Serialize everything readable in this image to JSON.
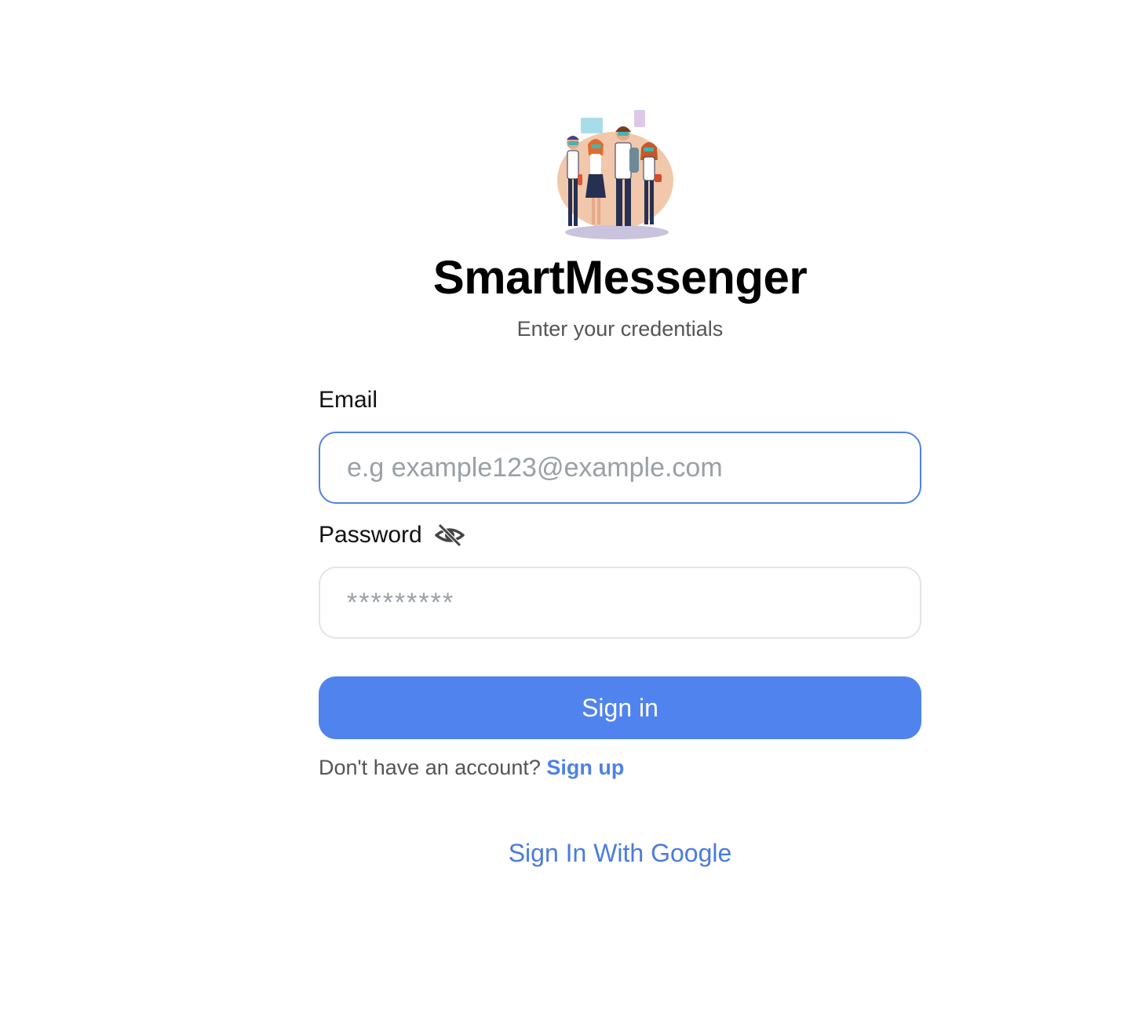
{
  "app": {
    "title": "SmartMessenger",
    "subtitle": "Enter your credentials"
  },
  "form": {
    "email_label": "Email",
    "email_placeholder": "e.g example123@example.com",
    "email_value": "",
    "password_label": "Password",
    "password_placeholder": "*********",
    "password_value": "",
    "signin_label": "Sign in",
    "signup_prompt": "Don't have an account?",
    "signup_link": "Sign up",
    "google_link": "Sign In With Google"
  },
  "icons": {
    "logo": "people-group-illustration",
    "password_toggle": "eye-slash-icon"
  },
  "colors": {
    "accent": "#5083EE",
    "link": "#4F81E6",
    "focus_border": "#4F81E6",
    "muted_text": "#555555",
    "placeholder": "#9AA0A8"
  }
}
